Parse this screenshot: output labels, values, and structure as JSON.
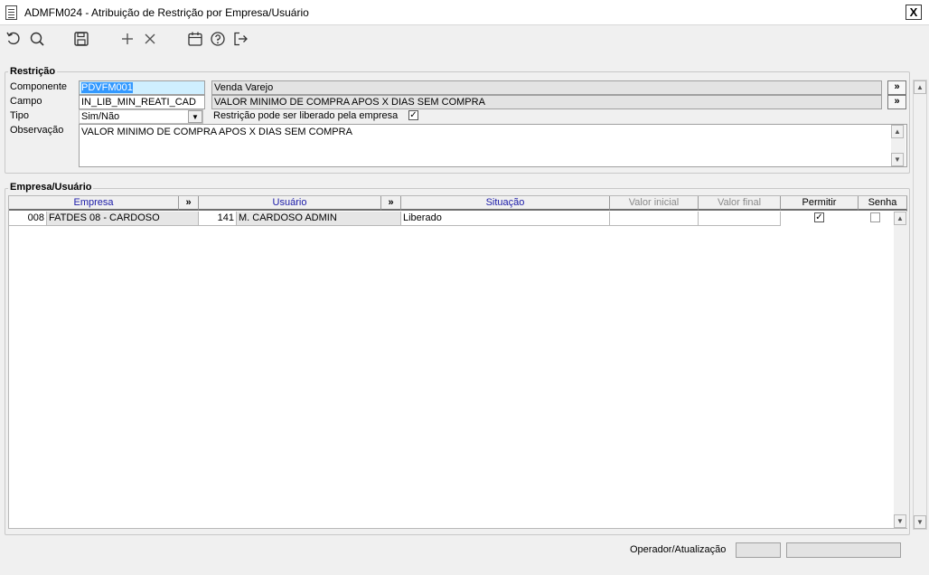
{
  "window": {
    "title": "ADMFM024 - Atribuição de Restrição por Empresa/Usuário",
    "close_label": "X"
  },
  "toolbar": {
    "buttons": [
      {
        "name": "refresh-icon"
      },
      {
        "name": "search-icon"
      },
      {
        "name": "save-icon"
      },
      {
        "name": "add-icon"
      },
      {
        "name": "delete-icon"
      },
      {
        "name": "calendar-icon"
      },
      {
        "name": "help-icon"
      },
      {
        "name": "exit-icon"
      }
    ]
  },
  "restricao": {
    "legend": "Restrição",
    "componente_label": "Componente",
    "componente_value": "PDVFM001",
    "componente_desc": "Venda Varejo",
    "campo_label": "Campo",
    "campo_value": "IN_LIB_MIN_REATI_CAD",
    "campo_desc": "VALOR MINIMO DE COMPRA APOS X DIAS SEM COMPRA",
    "tipo_label": "Tipo",
    "tipo_value": "Sim/Não",
    "liberado_label": "Restrição pode ser liberado pela empresa",
    "liberado_checked": true,
    "observacao_label": "Observação",
    "observacao_value": "VALOR MINIMO DE COMPRA APOS X DIAS SEM COMPRA",
    "lookup_label": "»"
  },
  "empresa_usuario": {
    "legend": "Empresa/Usuário",
    "columns": {
      "empresa": "Empresa",
      "empresa_lookup": "»",
      "usuario": "Usuário",
      "usuario_lookup": "»",
      "situacao": "Situação",
      "valor_inicial": "Valor inicial",
      "valor_final": "Valor final",
      "permitir": "Permitir",
      "senha": "Senha"
    },
    "rows": [
      {
        "empresa_cod": "008",
        "empresa_nome": "FATDES 08 - CARDOSO",
        "usuario_cod": "141",
        "usuario_nome": "M. CARDOSO ADMIN",
        "situacao": "Liberado",
        "valor_inicial": "",
        "valor_final": "",
        "permitir": true,
        "senha": false
      }
    ]
  },
  "footer": {
    "operador_label": "Operador/Atualização",
    "operador_value": "",
    "atualizacao_value": ""
  }
}
